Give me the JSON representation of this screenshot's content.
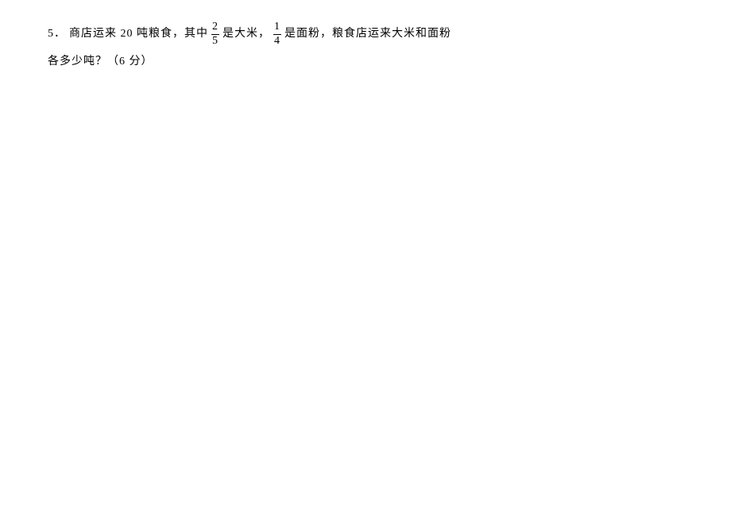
{
  "question": {
    "number": "5．",
    "segA": "商店运来 20 吨粮食，其中",
    "frac1_num": "2",
    "frac1_den": "5",
    "segB": "是大米，",
    "frac2_num": "1",
    "frac2_den": "4",
    "segC": "是面粉，粮食店运来大米和面粉",
    "line2": "各多少吨？（6 分）"
  }
}
